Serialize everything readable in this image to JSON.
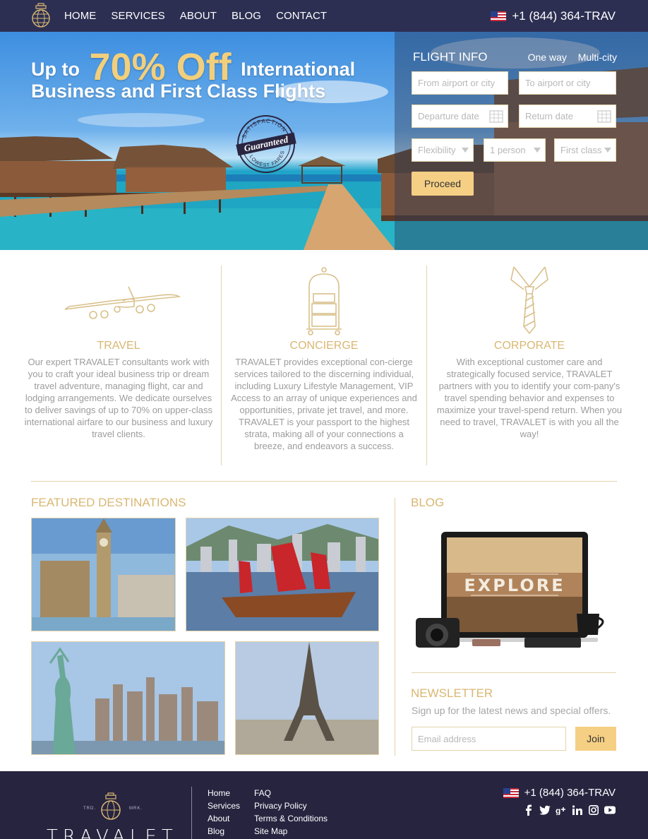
{
  "nav": {
    "items": [
      "HOME",
      "SERVICES",
      "ABOUT",
      "BLOG",
      "CONTACT"
    ],
    "phone": "+1 (844) 364-TRAV"
  },
  "hero": {
    "line1_pre": "Up to",
    "line1_big": "70% Off",
    "line1_post": "International",
    "line2": "Business and First Class Flights",
    "stamp_top": "SATISFACTION",
    "stamp_mid": "Guaranteed",
    "stamp_bottom": "LOWEST FARES"
  },
  "flight": {
    "title": "FLIGHT INFO",
    "option_one_way": "One way",
    "option_multi": "Multi-city",
    "from_placeholder": "From airport or city",
    "to_placeholder": "To airport or city",
    "depart_placeholder": "Departure date",
    "return_placeholder": "Return date",
    "flexibility": "Flexibility",
    "persons": "1 person",
    "class": "First class",
    "proceed": "Proceed"
  },
  "services": [
    {
      "title": "TRAVEL",
      "text": "Our expert TRAVALET consultants work with you to craft your ideal business trip or dream travel adventure, managing flight, car and lodging arrangements. We dedicate ourselves to deliver savings of up to 70% on upper-class international airfare to our business and luxury travel clients."
    },
    {
      "title": "CONCIERGE",
      "text": "TRAVALET provides exceptional con-cierge services tailored to the discerning individual, including Luxury Lifestyle Management, VIP Access to an array of unique experiences and opportunities, private jet travel, and more. TRAVALET is your passport to the highest strata, making all of your connections a breeze, and endeavors a success."
    },
    {
      "title": "CORPORATE",
      "text": "With exceptional customer care and strategically focused service, TRAVALET partners with you to identify your com-pany's travel spending behavior and expenses to maximize your travel-spend return. When you need to travel, TRAVALET is with you all the way!"
    }
  ],
  "featured": {
    "title": "FEATURED DESTINATIONS"
  },
  "blog": {
    "title": "BLOG",
    "image_word": "EXPLORE"
  },
  "newsletter": {
    "title": "NEWSLETTER",
    "subtitle": "Sign up for the latest news and special offers.",
    "email_placeholder": "Email address",
    "join": "Join"
  },
  "footer": {
    "tm_left": "TRD.",
    "tm_right": "MRK.",
    "brand": "TRAVALET",
    "links_col1": [
      "Home",
      "Services",
      "About",
      "Blog"
    ],
    "links_col2": [
      "FAQ",
      "Privacy Policy",
      "Terms & Conditions",
      "Site Map"
    ],
    "phone": "+1 (844) 364-TRAV"
  },
  "colors": {
    "navy": "#2c2f52",
    "gold": "#d9b772",
    "button": "#f5cf84",
    "footer": "#272440"
  }
}
